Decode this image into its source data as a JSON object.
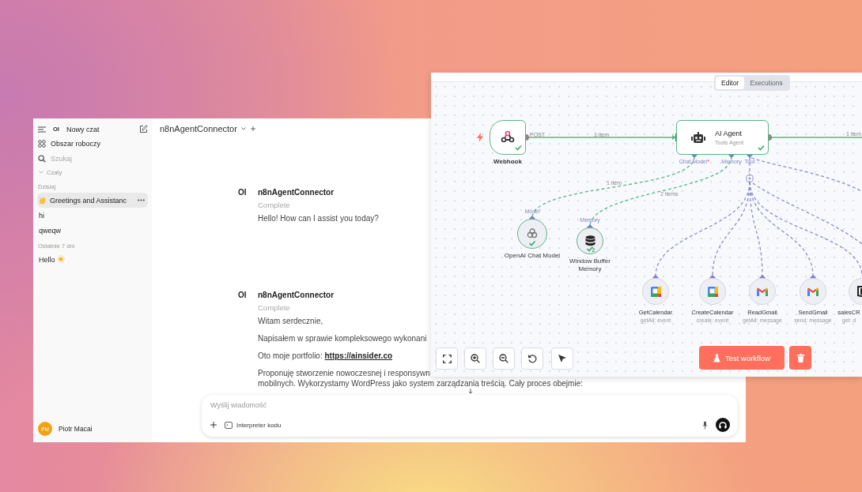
{
  "chat": {
    "sidebar": {
      "logo": "OI",
      "new_chat": "Nowy czat",
      "workspace": "Obszar roboczy",
      "search_placeholder": "Szukaj",
      "section": "Czaty",
      "groups": [
        {
          "label": "Dzisiaj",
          "items": [
            {
              "title": "Greetings and Assistanc",
              "selected": true
            },
            {
              "title": "hi",
              "selected": false
            },
            {
              "title": "qweqw",
              "selected": false
            }
          ]
        },
        {
          "label": "Ostatnie 7 dni",
          "items": [
            {
              "title": "Hello",
              "selected": false
            }
          ]
        }
      ],
      "user": {
        "initials": "PM",
        "name": "Piotr Macai"
      }
    },
    "model": "n8nAgentConnector",
    "messages": [
      {
        "logo": "OI",
        "author": "n8nAgentConnector",
        "status": "Complete",
        "paragraphs": [
          {
            "lines": [
              "Hello! How can I assist you today?"
            ]
          }
        ]
      },
      {
        "logo": "OI",
        "author": "n8nAgentConnector",
        "status": "Complete",
        "paragraphs": [
          {
            "lines": [
              "Witam serdecznie,"
            ]
          },
          {
            "lines": [
              "Napisałem w sprawie kompleksowego wykonani"
            ]
          },
          {
            "lines": [
              "Oto moje portfolio: "
            ],
            "link": "https://ainsider.co"
          },
          {
            "lines": [
              "Proponuję stworzenie nowoczesnej i responsywn",
              "mobilnych. Wykorzystamy WordPress jako system zarządzania treścią. Cały proces obejmie:"
            ]
          }
        ]
      }
    ],
    "composer": {
      "placeholder": "Wyślij wiadomość",
      "tool": "Interpreter kodu"
    }
  },
  "workflow": {
    "tabs": [
      {
        "label": "Editor",
        "selected": true
      },
      {
        "label": "Executions",
        "selected": false
      }
    ],
    "nodes": [
      {
        "kind": "trigger",
        "name": "Webhook",
        "output_label": "POST",
        "success": true
      },
      {
        "kind": "agent",
        "name": "AI Agent",
        "subtitle": "Tools Agent",
        "success": true,
        "inputs": [
          {
            "label": "Chat Model",
            "mark": "*"
          },
          {
            "label": "Memory"
          },
          {
            "label": "Tool"
          }
        ]
      },
      {
        "kind": "sub",
        "name": "OpenAI Chat Model",
        "port": "Model",
        "success": true
      },
      {
        "kind": "sub",
        "name": "Window Buffer Memory",
        "port": "Memory",
        "success": true,
        "runs": "2"
      },
      {
        "kind": "tool",
        "name": "GetCalendar",
        "subtitle": "getAll: event",
        "success": false
      },
      {
        "kind": "tool",
        "name": "CreateCalendar",
        "subtitle": "create: event",
        "success": false
      },
      {
        "kind": "tool",
        "name": "ReadGmail",
        "subtitle": "getAll: message",
        "success": false
      },
      {
        "kind": "tool",
        "name": "SendGmail",
        "subtitle": "send: message",
        "success": false
      },
      {
        "kind": "tool",
        "name": "salesCR",
        "subtitle": "get: d",
        "success": false
      }
    ],
    "connections": [
      {
        "kind": "main",
        "label": "1 item"
      },
      {
        "kind": "main",
        "label": "1 item"
      },
      {
        "kind": "ai",
        "label": "1 item"
      },
      {
        "kind": "ai",
        "label": "2 items"
      }
    ],
    "test_button": "Test workflow"
  }
}
